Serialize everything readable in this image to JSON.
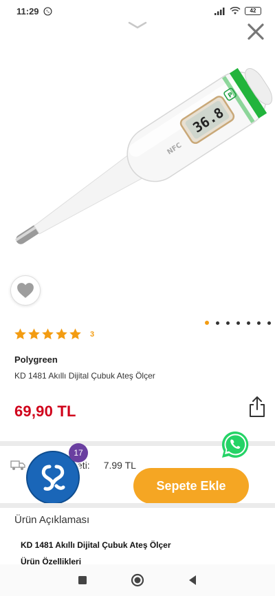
{
  "status_bar": {
    "time": "11:29",
    "battery": "42"
  },
  "product": {
    "brand": "Polygreen",
    "name": "KD 1481  Akıllı Dijital Çubuk Ateş Ölçer",
    "price": "69,90 TL",
    "rating": {
      "stars": 5,
      "count": "3"
    },
    "image": {
      "display_reading": "36.8",
      "label": "NFC"
    },
    "carousel": {
      "total": 7,
      "active_index": 0
    }
  },
  "shipping": {
    "label": "Kargo Ücreti:",
    "value": "7.99 TL"
  },
  "actions": {
    "add_to_cart": "Sepete Ekle"
  },
  "assistant": {
    "badge_count": "17"
  },
  "description": {
    "heading": "Ürün Açıklaması",
    "title": "KD 1481 Akıllı Dijital Çubuk Ateş Ölçer",
    "features_title": "Ürün Özellikleri"
  },
  "icons": {
    "whatsapp": "whatsapp-icon",
    "share": "share-icon",
    "favorite": "heart-icon",
    "close": "close-icon"
  },
  "colors": {
    "accent": "#f5a623",
    "price": "#d0021b",
    "star": "#f39c12",
    "whatsapp": "#25d366",
    "badge": "#6a3fa0"
  }
}
